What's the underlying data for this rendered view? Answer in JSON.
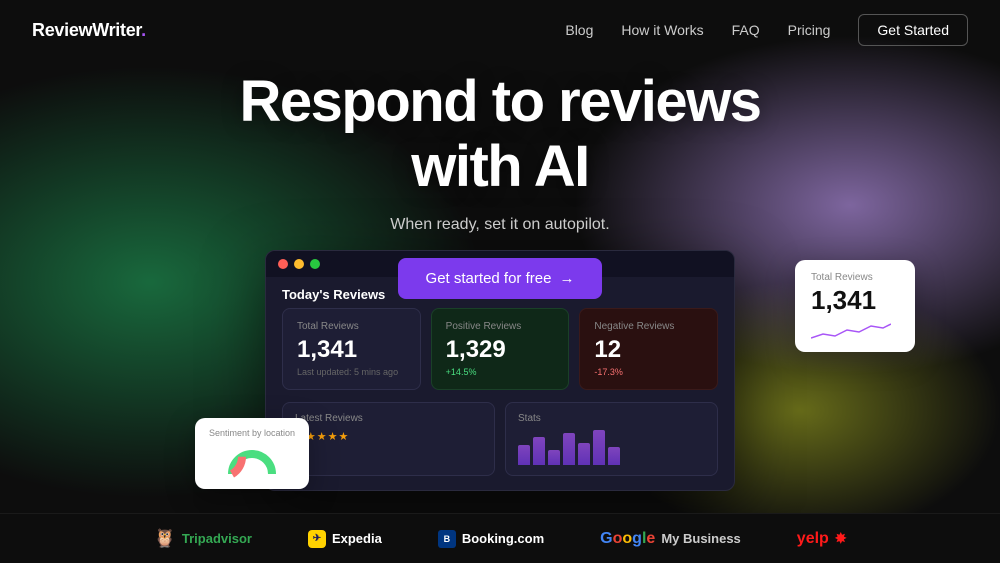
{
  "nav": {
    "logo": "ReviewWriter",
    "logo_dot": ".",
    "links": [
      "Blog",
      "How it Works",
      "FAQ",
      "Pricing"
    ],
    "cta": "Get Started"
  },
  "hero": {
    "title_line1": "Respond to reviews",
    "title_line2": "with AI",
    "subtitle": "When ready, set it on autopilot.",
    "cta": "Get started for free",
    "arrow": "→"
  },
  "dashboard": {
    "title": "Today's Reviews",
    "stats": [
      {
        "label": "Total Reviews",
        "value": "1,341",
        "sub": "Last updated: 5 mins ago",
        "type": "default"
      },
      {
        "label": "Positive Reviews",
        "value": "1,329",
        "change": "+14.5%",
        "type": "positive"
      },
      {
        "label": "Negative Reviews",
        "value": "12",
        "change": "-17.3%",
        "type": "negative"
      }
    ],
    "sections": [
      {
        "label": "Latest Reviews",
        "stars": "★★★★★"
      },
      {
        "label": "Stats"
      }
    ]
  },
  "float_total": {
    "label": "Total Reviews",
    "value": "1,341"
  },
  "float_sentiment": {
    "label": "Sentiment by location"
  },
  "partners": [
    {
      "name": "Tripadvisor",
      "id": "tripadvisor"
    },
    {
      "name": "Expedia",
      "id": "expedia"
    },
    {
      "name": "Booking.com",
      "id": "booking"
    },
    {
      "name": "Google My Business",
      "id": "google"
    },
    {
      "name": "yelp",
      "id": "yelp"
    }
  ]
}
